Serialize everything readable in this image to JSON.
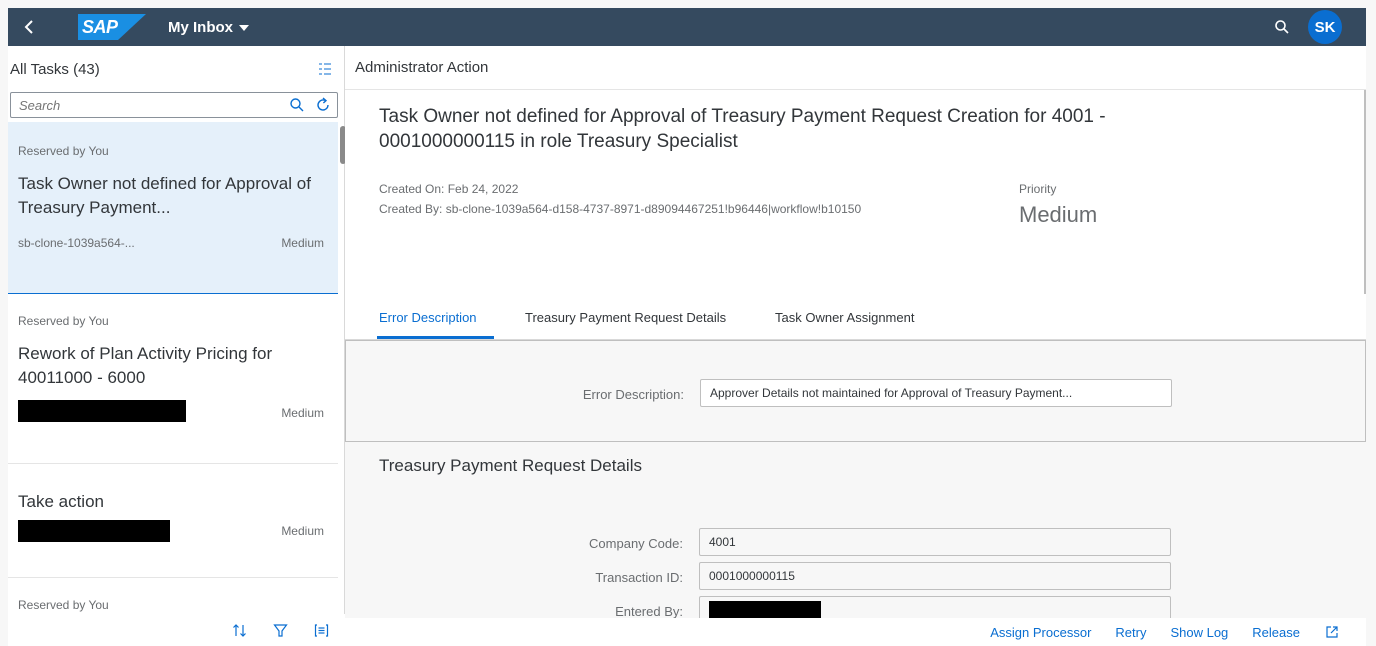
{
  "shell": {
    "logo_text": "SAP",
    "app_title": "My Inbox",
    "avatar_initials": "SK"
  },
  "master": {
    "title": "All Tasks (43)",
    "search_placeholder": "Search",
    "items": [
      {
        "status": "Reserved by You",
        "title": "Task Owner not defined for Approval of Treasury Payment...",
        "created_by": "sb-clone-1039a564-...",
        "priority": "Medium"
      },
      {
        "status": "Reserved by You",
        "title": "Rework of Plan Activity Pricing for 40011000 - 6000",
        "priority": "Medium"
      },
      {
        "title": "Take action",
        "priority": "Medium"
      },
      {
        "status": "Reserved by You"
      }
    ]
  },
  "detail": {
    "header": "Administrator Action",
    "task_title": "Task Owner not defined for Approval of Treasury Payment Request Creation for 4001 - 0001000000115 in role Treasury Specialist",
    "created_on": "Created On: Feb 24, 2022",
    "created_by": "Created By: sb-clone-1039a564-d158-4737-8971-d89094467251!b96446|workflow!b10150",
    "priority_label": "Priority",
    "priority_value": "Medium",
    "tabs": [
      "Error Description",
      "Treasury Payment Request Details",
      "Task Owner Assignment"
    ],
    "error_label": "Error Description:",
    "error_value": "Approver Details not maintained for Approval of Treasury Payment...",
    "section_title": "Treasury Payment Request Details",
    "fields": [
      {
        "label": "Company Code:",
        "value": "4001"
      },
      {
        "label": "Transaction ID:",
        "value": "0001000000115"
      },
      {
        "label": "Entered By:",
        "value": ""
      }
    ],
    "footer_buttons": [
      "Assign Processor",
      "Retry",
      "Show Log",
      "Release"
    ]
  },
  "colors": {
    "shell_bg": "#354a5f",
    "accent": "#0a6ed1",
    "selected_bg": "#e5f0fa"
  }
}
